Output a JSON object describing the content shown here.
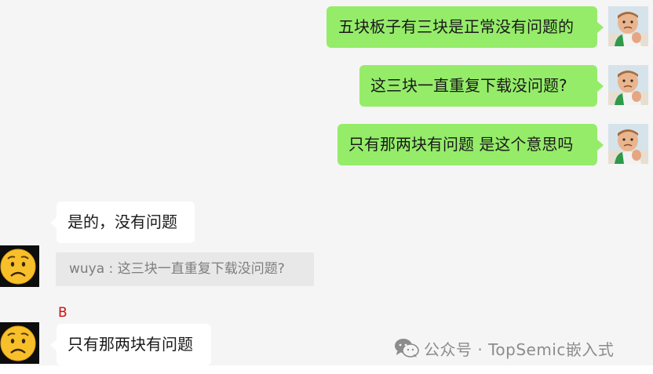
{
  "chat": {
    "messages": [
      {
        "text": "五块板子有三块是正常没有问题的"
      },
      {
        "text": "这三块一直重复下载没问题?"
      },
      {
        "text": "只有那两块有问题 是这个意思吗"
      },
      {
        "text": "是的，没有问题"
      },
      {
        "text": "只有那两块有问题"
      }
    ],
    "quote": {
      "text": "wuya : 这三块一直重复下载没问题?"
    },
    "sender": {
      "name": "B"
    }
  },
  "watermark": {
    "text": "公众号 · TopSemic嵌入式",
    "icon": "wechat-icon"
  },
  "colors": {
    "outgoing_bubble": "#95ec69",
    "incoming_bubble": "#ffffff",
    "background": "#f5f5f5",
    "sender_name": "#cc1111"
  }
}
